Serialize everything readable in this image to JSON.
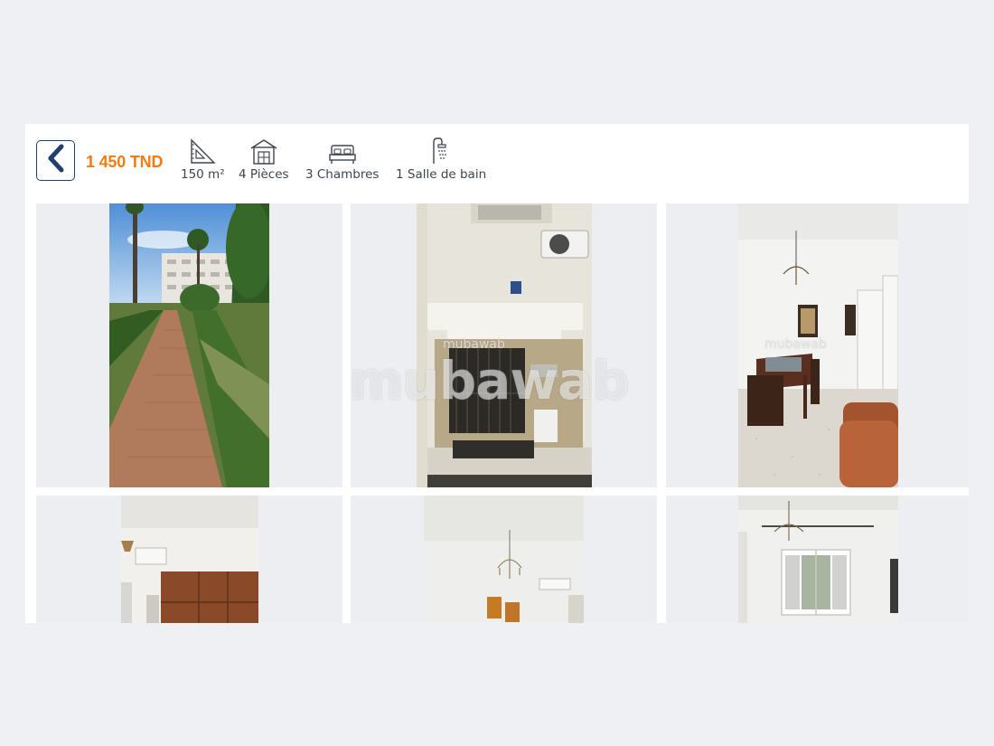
{
  "listing": {
    "price": "1 450 TND",
    "features": [
      {
        "icon": "set-square-icon",
        "label": "150 m²"
      },
      {
        "icon": "house-icon",
        "label": "4 Pièces"
      },
      {
        "icon": "bed-icon",
        "label": "3 Chambres"
      },
      {
        "icon": "shower-icon",
        "label": "1 Salle de bain"
      }
    ]
  },
  "watermark": {
    "text": "mubawab"
  },
  "photos": [
    {
      "name": "photo-garden-path"
    },
    {
      "name": "photo-building-entrance"
    },
    {
      "name": "photo-dining-room"
    },
    {
      "name": "photo-wardrobe-room"
    },
    {
      "name": "photo-living-room-chandelier"
    },
    {
      "name": "photo-room-window"
    }
  ],
  "colors": {
    "accent": "#f07d12",
    "back_button": "#1f3f6e",
    "page_background": "#eef0f4",
    "tile_background": "#eceef2"
  }
}
